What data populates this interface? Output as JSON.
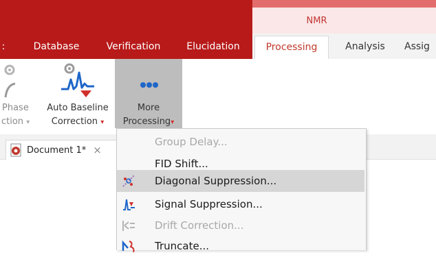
{
  "ribbon_tabs": {
    "context_label": "NMR",
    "left_cut": ":",
    "database": "Database",
    "verification": "Verification",
    "elucidation": "Elucidation",
    "processing": "Processing",
    "analysis": "Analysis",
    "assignment": "Assig"
  },
  "toolbar": {
    "phase_line1": "Phase",
    "phase_line2": "ction",
    "auto_baseline_line1": "Auto Baseline",
    "auto_baseline_line2": "Correction",
    "more_line1": "More",
    "more_line2": "Processing"
  },
  "document": {
    "tab_label": "Document 1*",
    "close_glyph": "×"
  },
  "menu": {
    "items": [
      {
        "label": "Group Delay...",
        "enabled": false,
        "icon": "group-delay-icon"
      },
      {
        "label": "FID Shift...",
        "enabled": true,
        "icon": "none"
      },
      {
        "label": "Diagonal Suppression...",
        "enabled": true,
        "icon": "diagonal-suppression-icon"
      },
      {
        "label": "Signal Suppression...",
        "enabled": true,
        "icon": "signal-suppression-icon"
      },
      {
        "label": "Drift Correction...",
        "enabled": false,
        "icon": "drift-correction-icon"
      },
      {
        "label": "Truncate...",
        "enabled": true,
        "icon": "truncate-icon"
      }
    ]
  },
  "colors": {
    "ribbon_red": "#b81a1a",
    "context_pink": "#fbe7e7",
    "accent_red": "#c0392b",
    "more_button_bg": "#bdbdbd"
  }
}
